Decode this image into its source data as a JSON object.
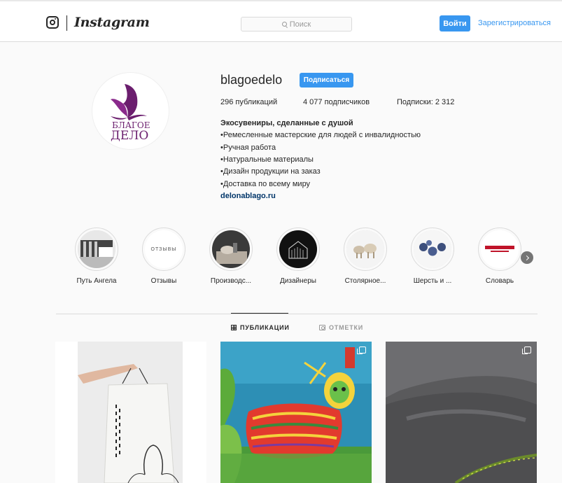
{
  "header": {
    "brand": "Instagram",
    "search_placeholder": "Поиск",
    "login_label": "Войти",
    "signup_label": "Зарегистрироваться"
  },
  "profile": {
    "username": "blagoedelo",
    "follow_label": "Подписаться",
    "avatar_text_top": "БЛАГОЕ",
    "avatar_text_bottom": "ДЕЛО",
    "stats": {
      "posts": "296 публикаций",
      "followers": "4 077 подписчиков",
      "following": "Подписки: 2 312"
    },
    "bio_title": "Экосувениры, сделанные с душой",
    "bio_lines": [
      "•Ремесленные мастерские для людей с инвалидностью",
      "•Ручная работа",
      "•Натуральные материалы",
      "•Дизайн продукции на заказ",
      "•Доставка по всему миру"
    ],
    "website": "delonablago.ru"
  },
  "highlights": [
    {
      "label": "Путь Ангела"
    },
    {
      "label": "Отзывы",
      "inner_text": "ОТЗЫВЫ"
    },
    {
      "label": "Производс..."
    },
    {
      "label": "Дизайнеры"
    },
    {
      "label": "Столярное..."
    },
    {
      "label": "Шерсть и ..."
    },
    {
      "label": "Словарь"
    }
  ],
  "tabs": {
    "posts": "ПУБЛИКАЦИИ",
    "tagged": "ОТМЕТКИ"
  },
  "colors": {
    "accent": "#3897f0",
    "brand_purple": "#6b1e6e",
    "link": "#003569"
  }
}
